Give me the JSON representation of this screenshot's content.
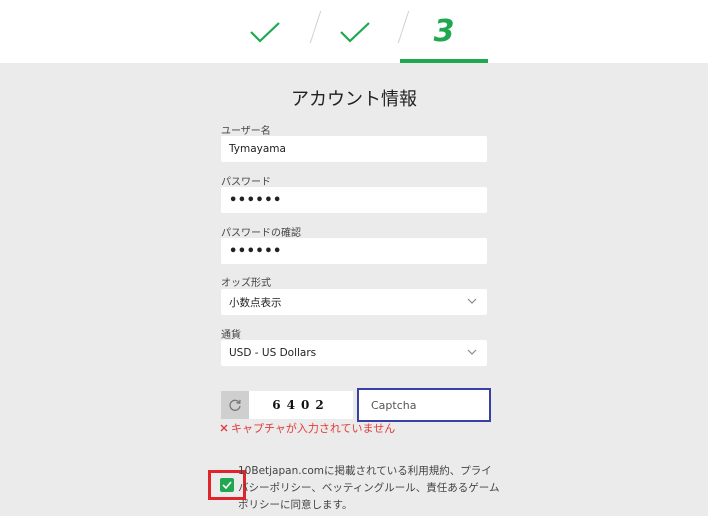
{
  "stepper": {
    "step1_icon": "check-icon",
    "step2_icon": "check-icon",
    "step3_number": "3",
    "accent_color": "#1fa84f"
  },
  "form": {
    "title": "アカウント情報",
    "username": {
      "label": "ユーザー名",
      "value": "Tymayama"
    },
    "password": {
      "label": "パスワード",
      "value": "••••••"
    },
    "password_confirm": {
      "label": "パスワードの確認",
      "value": "••••••"
    },
    "odds_format": {
      "label": "オッズ形式",
      "selected": "小数点表示"
    },
    "currency": {
      "label": "通貨",
      "selected": "USD - US Dollars"
    },
    "captcha": {
      "code": "6402",
      "placeholder": "Captcha",
      "error": "キャプチャが入力されていません",
      "error_icon": "x-icon",
      "refresh_icon": "refresh-icon"
    },
    "terms": {
      "checked": true,
      "text": "10Betjapan.comに掲載されている利用規約、プライバシーポリシー、ベッティングルール、責任あるゲームポリシーに同意します。"
    }
  }
}
